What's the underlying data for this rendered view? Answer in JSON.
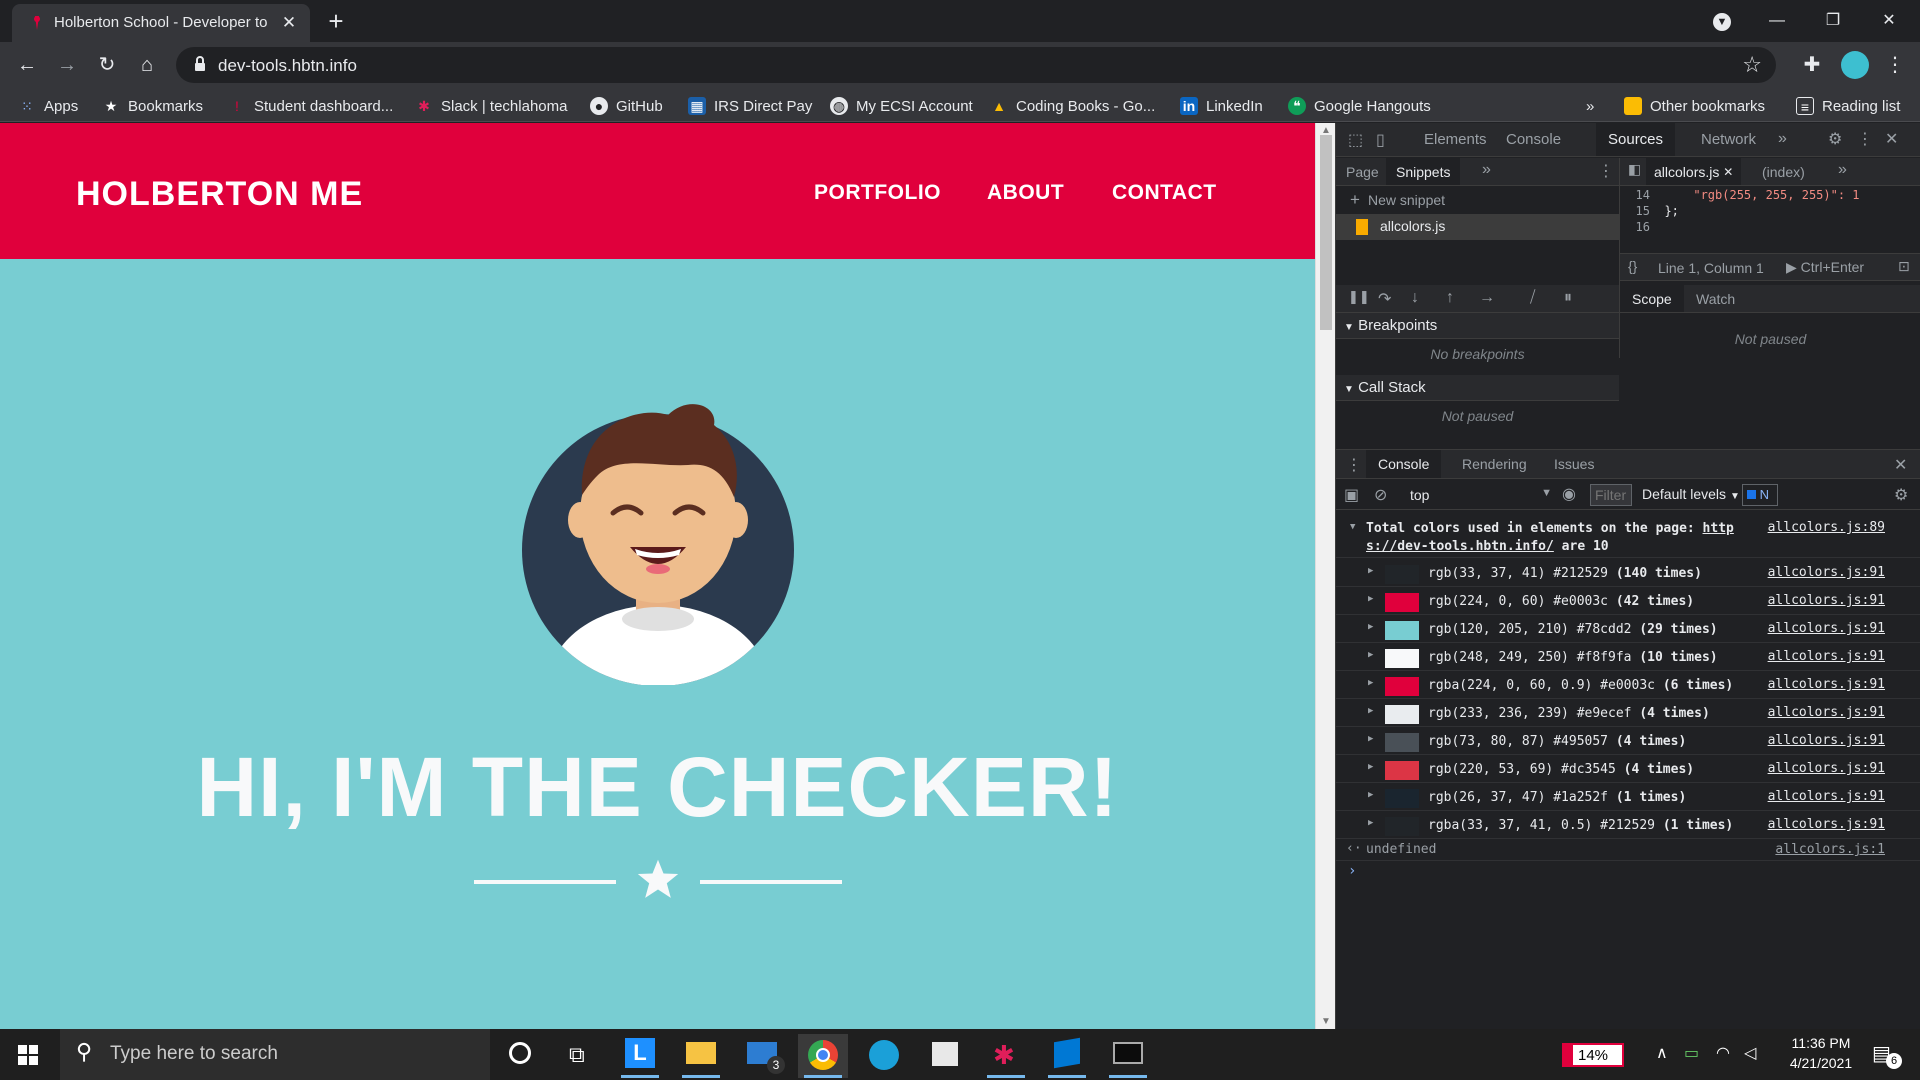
{
  "browser": {
    "tab_title": "Holberton School - Developer to",
    "url": "dev-tools.hbtn.info",
    "bookmarks": [
      {
        "label": "Apps",
        "icon": "apps-grid-icon"
      },
      {
        "label": "Bookmarks",
        "icon": "star-icon"
      },
      {
        "label": "Student dashboard...",
        "icon": "holberton-icon"
      },
      {
        "label": "Slack | techlahoma",
        "icon": "slack-icon"
      },
      {
        "label": "GitHub",
        "icon": "github-icon"
      },
      {
        "label": "IRS Direct Pay",
        "icon": "irs-icon"
      },
      {
        "label": "My ECSI Account",
        "icon": "globe-icon"
      },
      {
        "label": "Coding Books - Go...",
        "icon": "drive-icon"
      },
      {
        "label": "LinkedIn",
        "icon": "linkedin-icon"
      },
      {
        "label": "Google Hangouts",
        "icon": "hangouts-icon"
      }
    ],
    "overflow": "»",
    "other_bookmarks": "Other bookmarks",
    "reading_list": "Reading list"
  },
  "page": {
    "logo": "HOLBERTON ME",
    "nav": [
      "PORTFOLIO",
      "ABOUT",
      "CONTACT"
    ],
    "hero_title": "HI, I'M THE CHECKER!",
    "colors": {
      "header": "#e0003c",
      "background": "#78cdd2",
      "text": "#f8f9fa",
      "avatar_bg": "#212529"
    }
  },
  "devtools": {
    "main_tabs": [
      "Elements",
      "Console",
      "Sources",
      "Network"
    ],
    "active_main_tab": "Sources",
    "nav_tabs": [
      "Page",
      "Snippets"
    ],
    "new_snippet": "New snippet",
    "snippet_file": "allcolors.js",
    "editor_tabs": [
      "allcolors.js",
      "(index)"
    ],
    "code_lines": [
      {
        "num": "14",
        "code": "    \"rgb(255, 255, 255)\": 1"
      },
      {
        "num": "15",
        "code": "};"
      },
      {
        "num": "16",
        "code": ""
      }
    ],
    "cursor_position": "Line 1, Column 1",
    "run_hint": "Ctrl+Enter",
    "breakpoints_label": "Breakpoints",
    "no_breakpoints": "No breakpoints",
    "call_stack_label": "Call Stack",
    "not_paused": "Not paused",
    "scope_tabs": [
      "Scope",
      "Watch"
    ],
    "drawer_tabs": [
      "Console",
      "Rendering",
      "Issues"
    ],
    "context": "top",
    "filter_placeholder": "Filter",
    "levels": "Default levels",
    "n_badge": "N",
    "summary": {
      "prefix": "Total colors used in elements on the page: ",
      "link1": "http",
      "link2": "s://dev-tools.hbtn.info/",
      "suffix": " are 10",
      "source": "allcolors.js:89"
    },
    "logs": [
      {
        "text": "rgb(33, 37, 41) #212529 ",
        "count": "(140 times)",
        "swatch": "#212529",
        "source": "allcolors.js:91"
      },
      {
        "text": "rgb(224, 0, 60) #e0003c ",
        "count": "(42 times)",
        "swatch": "#e0003c",
        "source": "allcolors.js:91"
      },
      {
        "text": "rgb(120, 205, 210) #78cdd2 ",
        "count": "(29 times)",
        "swatch": "#78cdd2",
        "source": "allcolors.js:91"
      },
      {
        "text": "rgb(248, 249, 250) #f8f9fa ",
        "count": "(10 times)",
        "swatch": "#f8f9fa",
        "source": "allcolors.js:91"
      },
      {
        "text": "rgba(224, 0, 60, 0.9) #e0003c ",
        "count": "(6 times)",
        "swatch": "#e0003c",
        "source": "allcolors.js:91"
      },
      {
        "text": "rgb(233, 236, 239) #e9ecef ",
        "count": "(4 times)",
        "swatch": "#e9ecef",
        "source": "allcolors.js:91"
      },
      {
        "text": "rgb(73, 80, 87) #495057 ",
        "count": "(4 times)",
        "swatch": "#495057",
        "source": "allcolors.js:91"
      },
      {
        "text": "rgb(220, 53, 69) #dc3545 ",
        "count": "(4 times)",
        "swatch": "#dc3545",
        "source": "allcolors.js:91"
      },
      {
        "text": "rgb(26, 37, 47) #1a252f ",
        "count": "(1 times)",
        "swatch": "#1a252f",
        "source": "allcolors.js:91"
      },
      {
        "text": "rgba(33, 37, 41, 0.5) #212529 ",
        "count": "(1 times)",
        "swatch": "#212529",
        "source": "allcolors.js:91"
      }
    ],
    "result": "undefined",
    "result_source": "allcolors.js:1"
  },
  "taskbar": {
    "search_placeholder": "Type here to search",
    "battery": "14%",
    "time": "11:36 PM",
    "date": "4/21/2021",
    "notifications": "6",
    "mail_badge": "3"
  }
}
